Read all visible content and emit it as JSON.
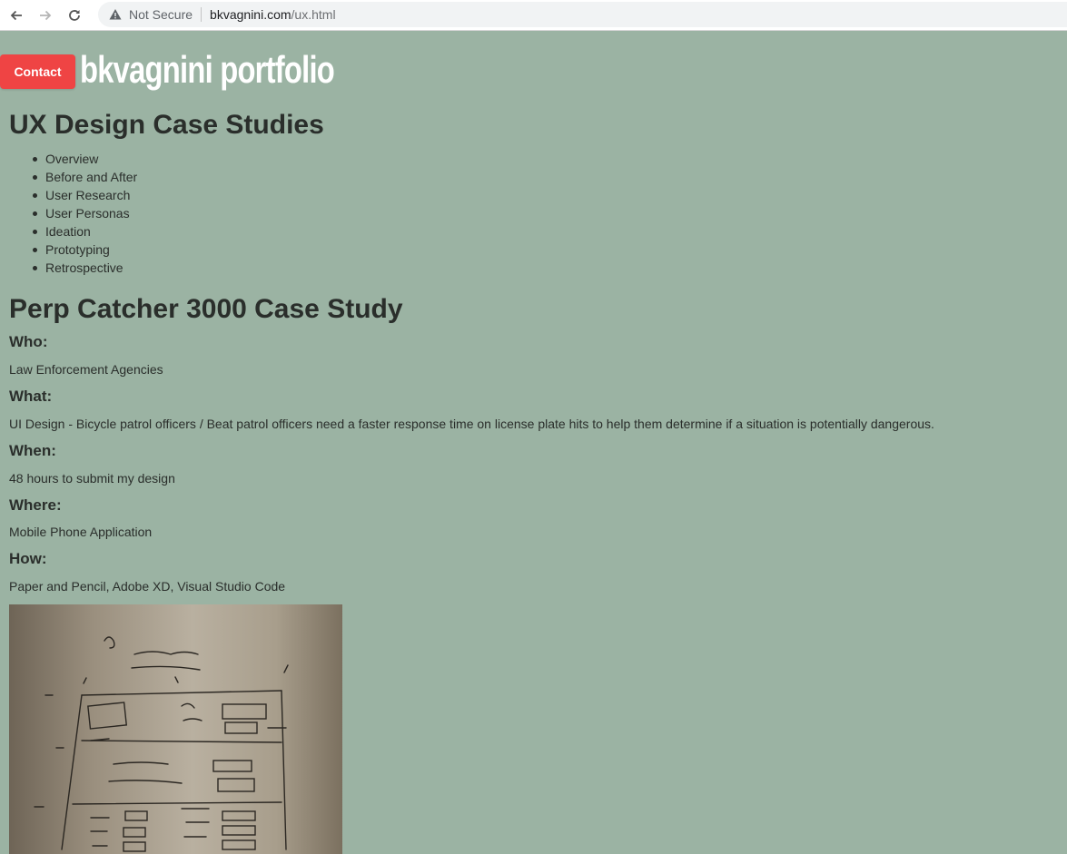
{
  "browser": {
    "security_label": "Not Secure",
    "url_host": "bkvagnini.com",
    "url_path": "/ux.html"
  },
  "header": {
    "contact_label": "Contact",
    "site_title": "bkvagnini portfolio"
  },
  "toc": {
    "title": "UX Design Case Studies",
    "items": [
      "Overview",
      "Before and After",
      "User Research",
      "User Personas",
      "Ideation",
      "Prototyping",
      "Retrospective"
    ]
  },
  "case_study": {
    "title": "Perp Catcher 3000 Case Study",
    "who_q": "Who:",
    "who_a": "Law Enforcement Agencies",
    "what_q": "What:",
    "what_a": "UI Design - Bicycle patrol officers / Beat patrol officers need a faster response time on license plate hits to help them determine if a situation is potentially dangerous.",
    "when_q": "When:",
    "when_a": "48 hours to submit my design",
    "where_q": "Where:",
    "where_a": "Mobile Phone Application",
    "how_q": "How:",
    "how_a": "Paper and Pencil, Adobe XD, Visual Studio Code"
  },
  "colors": {
    "page_bg": "#9bb3a3",
    "contact_bg": "#ef4444",
    "title_color": "#ffffff"
  }
}
